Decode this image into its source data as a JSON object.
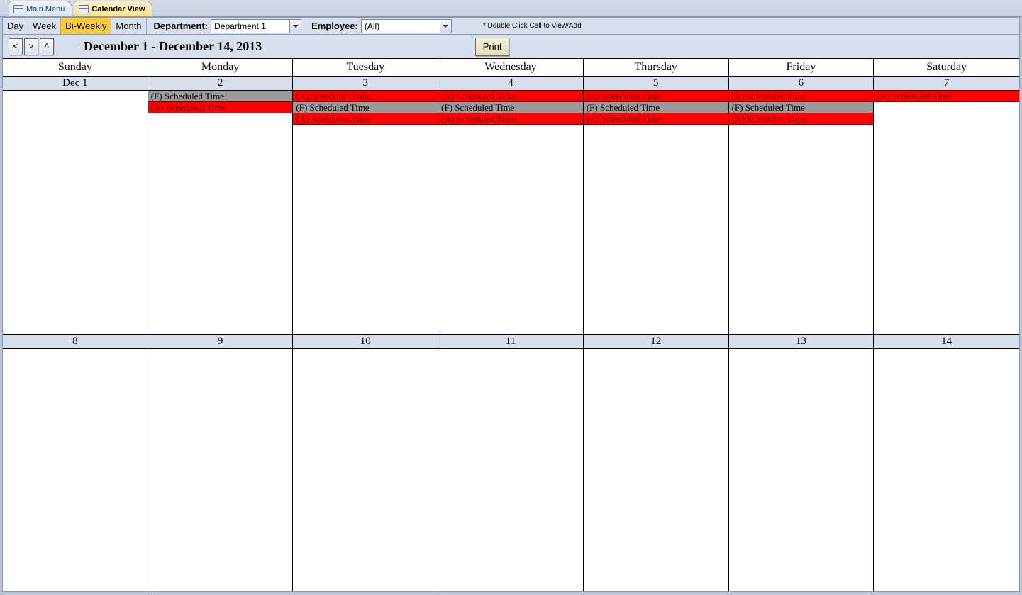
{
  "tabs": {
    "main_menu": "Main Menu",
    "calendar_view": "Calendar View"
  },
  "views": {
    "day": "Day",
    "week": "Week",
    "biweekly": "Bi-Weekly",
    "month": "Month",
    "active": "biweekly"
  },
  "filters": {
    "department_label": "Department:",
    "department_value": "Department 1",
    "employee_label": "Employee:",
    "employee_value": "(All)"
  },
  "hint": "* Double Click Cell to View/Add",
  "nav": {
    "prev": "<",
    "next": ">",
    "up": "^"
  },
  "range_title": "December 1 - December 14, 2013",
  "print_label": "Print",
  "weekdays": [
    "Sunday",
    "Monday",
    "Tuesday",
    "Wednesday",
    "Thursday",
    "Friday",
    "Saturday"
  ],
  "dates_w1": [
    "Dec 1",
    "2",
    "3",
    "4",
    "5",
    "6",
    "7"
  ],
  "dates_w2": [
    "8",
    "9",
    "10",
    "11",
    "12",
    "13",
    "14"
  ],
  "events_w1": [
    [],
    [
      {
        "t": "(F) Scheduled Time",
        "c": "gray"
      },
      {
        "t": "(A) Scheduled Time",
        "c": "red"
      }
    ],
    [
      {
        "t": "(A) Scheduled Time",
        "c": "red"
      },
      {
        "t": "(F) Scheduled Time",
        "c": "gray"
      },
      {
        "t": "(A) Scheduled Time",
        "c": "red"
      }
    ],
    [
      {
        "t": "(A) Scheduled Time",
        "c": "red"
      },
      {
        "t": "(F) Scheduled Time",
        "c": "gray"
      },
      {
        "t": "(A) Scheduled Time",
        "c": "red"
      }
    ],
    [
      {
        "t": "(A) Scheduled Time",
        "c": "red"
      },
      {
        "t": "(F) Scheduled Time",
        "c": "gray"
      },
      {
        "t": "(A) Scheduled Time",
        "c": "red"
      }
    ],
    [
      {
        "t": "(A) Scheduled Time",
        "c": "red"
      },
      {
        "t": "(F) Scheduled Time",
        "c": "gray"
      },
      {
        "t": "(A) Scheduled Time",
        "c": "red"
      }
    ],
    [
      {
        "t": "(A) Scheduled Time",
        "c": "red"
      }
    ]
  ],
  "events_w2": [
    [],
    [],
    [],
    [],
    [],
    [],
    []
  ]
}
